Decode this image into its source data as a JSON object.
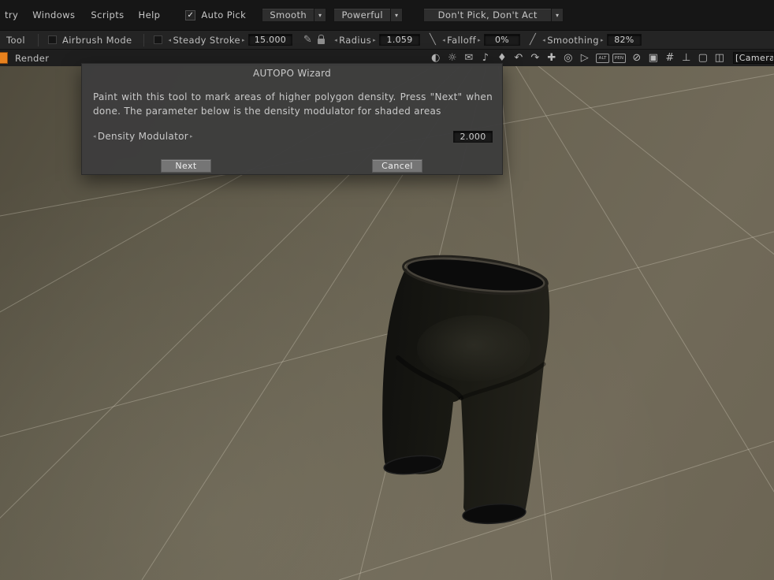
{
  "ui": {
    "spinner_left": "◂",
    "spinner_right": "▸",
    "dropdown_arrow": "▾",
    "check": "✓"
  },
  "menubar": {
    "items": [
      "try",
      "Windows",
      "Scripts",
      "Help"
    ],
    "auto_pick_label": "Auto Pick",
    "smooth_dropdown": "Smooth",
    "powerful_dropdown": "Powerful",
    "pick_dropdown": "Don't Pick, Don't Act"
  },
  "toolbar": {
    "tool_label": "Tool",
    "airbrush_label": "Airbrush Mode",
    "steady_stroke_label": "Steady Stroke",
    "steady_stroke_value": "15.000",
    "pencil_glyph": "✎",
    "stroke_glyph_1": "╱",
    "stroke_glyph_2": "╲",
    "radius_label": "Radius",
    "radius_value": "1.059",
    "falloff_label": "Falloff",
    "falloff_value": "0%",
    "smoothing_label": "Smoothing",
    "smoothing_value": "82%"
  },
  "viewbar": {
    "render_label": "Render",
    "camera_label": "[Camera",
    "icons": [
      {
        "name": "contrast",
        "glyph": "◐"
      },
      {
        "name": "lightbulb",
        "glyph": "☼"
      },
      {
        "name": "envelope",
        "glyph": "✉"
      },
      {
        "name": "note",
        "glyph": "♪"
      },
      {
        "name": "droplet",
        "glyph": "♦"
      },
      {
        "name": "undo",
        "glyph": "↶"
      },
      {
        "name": "redo",
        "glyph": "↷"
      },
      {
        "name": "move",
        "glyph": "✚"
      },
      {
        "name": "zoom",
        "glyph": "◎"
      },
      {
        "name": "play",
        "glyph": "▷"
      },
      {
        "name": "alt",
        "glyph": "ALT"
      },
      {
        "name": "pen",
        "glyph": "PEN"
      },
      {
        "name": "prohibit",
        "glyph": "⊘"
      },
      {
        "name": "box",
        "glyph": "▣"
      },
      {
        "name": "grid",
        "glyph": "#"
      },
      {
        "name": "pose",
        "glyph": "⊥"
      },
      {
        "name": "frame",
        "glyph": "▢"
      },
      {
        "name": "layers",
        "glyph": "◫"
      }
    ]
  },
  "dialog": {
    "title": "AUTOPO Wizard",
    "body": "Paint with this tool to mark areas of higher polygon density. Press \"Next\" when done. The parameter below is the density modulator for shaded areas",
    "density_label": "Density Modulator",
    "density_value": "2.000",
    "next_label": "Next",
    "cancel_label": "Cancel"
  }
}
